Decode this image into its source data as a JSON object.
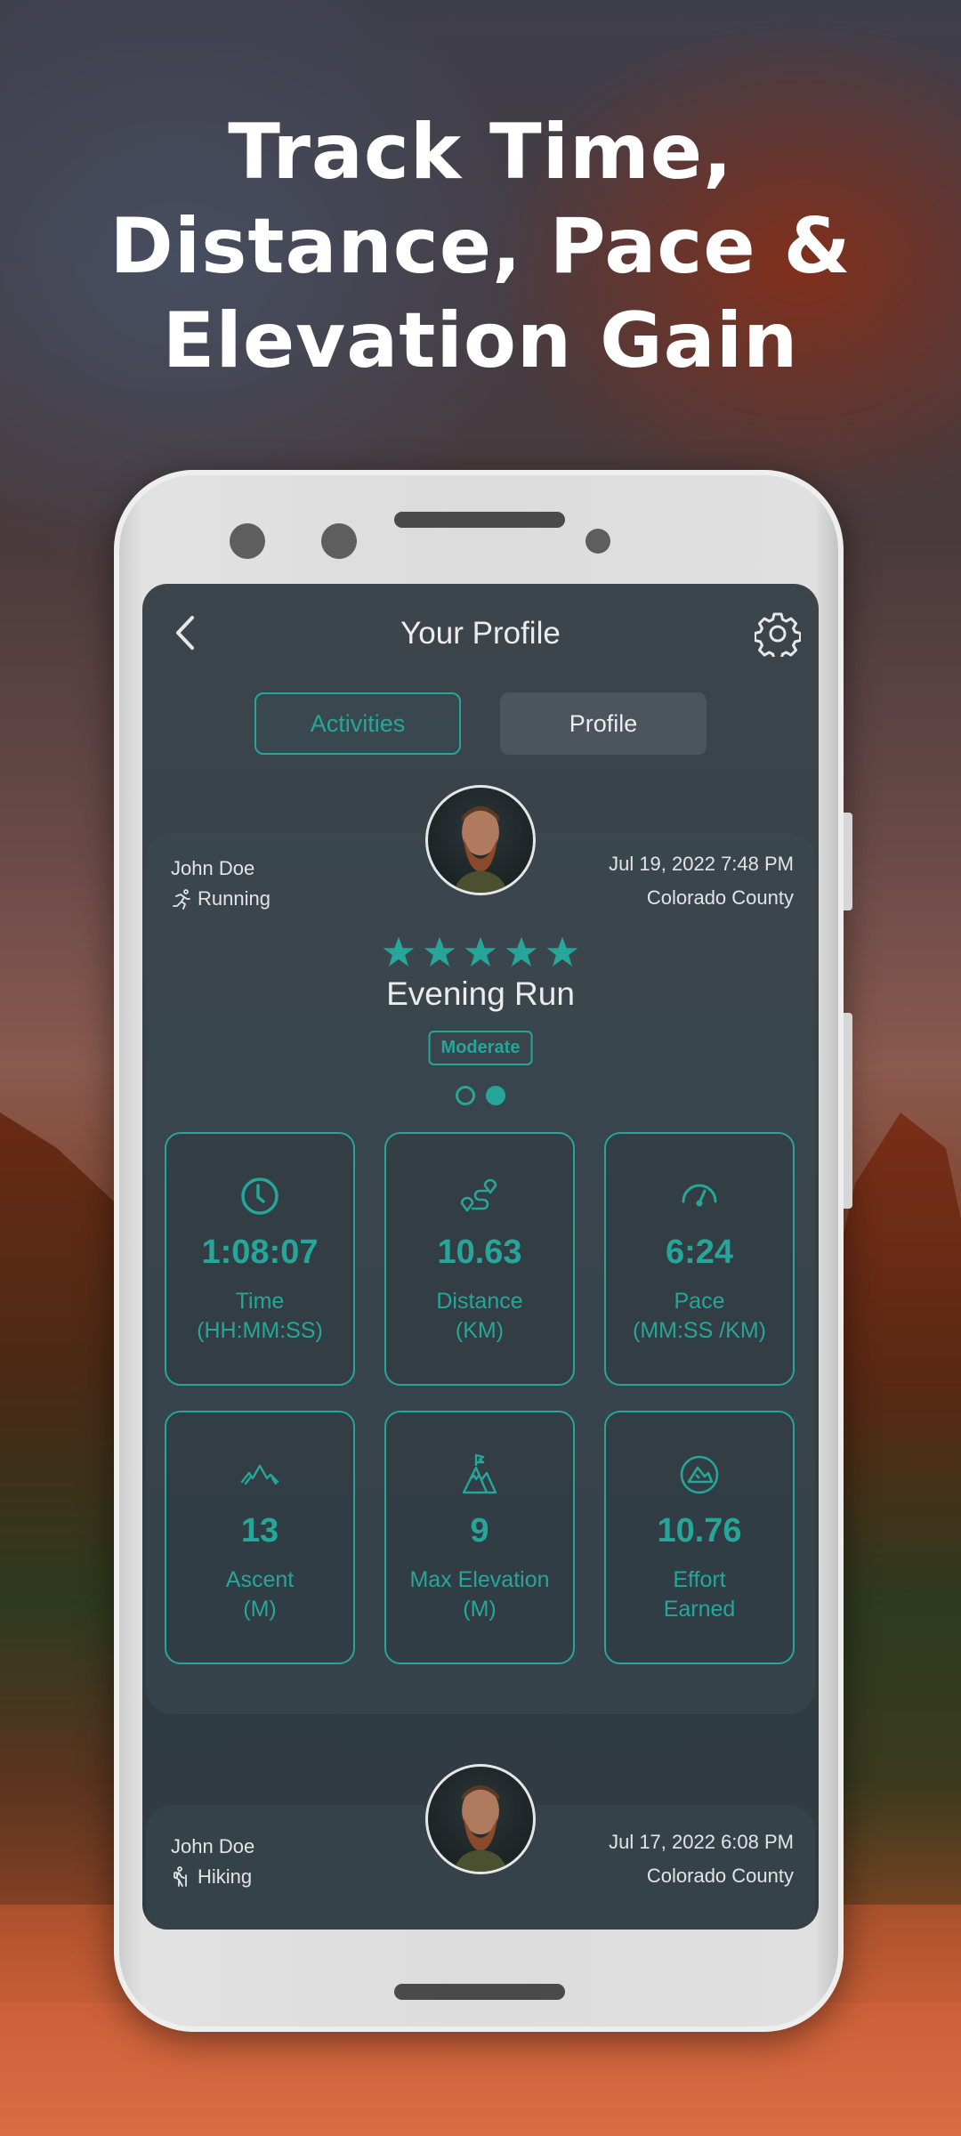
{
  "headline": {
    "lines": [
      "Track Time,",
      "Distance, Pace &",
      "Elevation Gain"
    ]
  },
  "colors": {
    "accent": "#26a69a",
    "screen_bg": "#364047",
    "text_light": "#ececec"
  },
  "app": {
    "title": "Your Profile",
    "back_icon": "chevron-left-icon",
    "settings_icon": "gear-icon",
    "tabs": [
      {
        "label": "Activities",
        "active": true
      },
      {
        "label": "Profile",
        "active": false
      }
    ]
  },
  "activities": [
    {
      "user_name": "John Doe",
      "activity_type": "Running",
      "activity_icon": "running-icon",
      "datetime": "Jul 19, 2022 7:48 PM",
      "location": "Colorado County",
      "rating": 5,
      "rating_max": 5,
      "title": "Evening Run",
      "difficulty": "Moderate",
      "pager": {
        "pages": 2,
        "current": 2
      },
      "stats": [
        {
          "icon": "clock-icon",
          "value": "1:08:07",
          "label": "Time",
          "unit": "(HH:MM:SS)"
        },
        {
          "icon": "route-icon",
          "value": "10.63",
          "label": "Distance",
          "unit": "(KM)"
        },
        {
          "icon": "speedometer-icon",
          "value": "6:24",
          "label": "Pace",
          "unit": "(MM:SS /KM)"
        },
        {
          "icon": "mountain-range-icon",
          "value": "13",
          "label": "Ascent",
          "unit": "(M)"
        },
        {
          "icon": "summit-flag-icon",
          "value": "9",
          "label": "Max Elevation",
          "unit": "(M)"
        },
        {
          "icon": "effort-badge-icon",
          "value": "10.76",
          "label": "Effort",
          "unit": "Earned"
        }
      ]
    },
    {
      "user_name": "John Doe",
      "activity_type": "Hiking",
      "activity_icon": "hiking-icon",
      "datetime": "Jul 17, 2022 6:08 PM",
      "location": "Colorado County"
    }
  ]
}
